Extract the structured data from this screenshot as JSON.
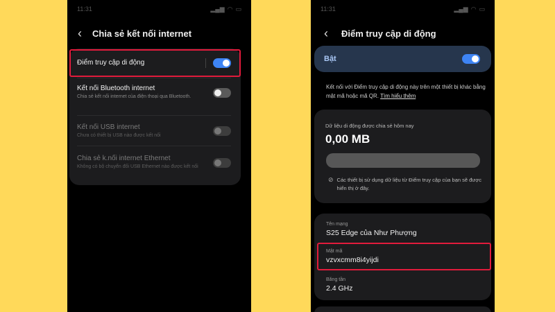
{
  "left": {
    "status": {
      "time": "11:31"
    },
    "header": {
      "title": "Chia sẻ kết nối internet"
    },
    "items": [
      {
        "title": "Điểm truy cập di động",
        "desc": "",
        "toggle": "on"
      },
      {
        "title": "Kết nối Bluetooth internet",
        "desc": "Chia sẻ kết nối internet của điện thoại qua Bluetooth.",
        "toggle": "off"
      },
      {
        "title": "Kết nối USB internet",
        "desc": "Chưa có thiết bị USB nào được kết nối",
        "toggle": "disabled"
      },
      {
        "title": "Chia sẻ k.nối internet Ethernet",
        "desc": "Không có bộ chuyển đổi USB Ethernet nào được kết nối",
        "toggle": "disabled"
      }
    ]
  },
  "right": {
    "status": {
      "time": "11:31"
    },
    "header": {
      "title": "Điểm truy cập di động"
    },
    "master": {
      "label": "Bật",
      "toggle": "on"
    },
    "info": {
      "text": "Kết nối với Điểm truy cập di động này trên một thiết bị khác bằng mật mã hoặc mã QR.",
      "link": "Tìm hiểu thêm"
    },
    "usage": {
      "label": "Dữ liệu di động được chia sẻ hôm nay",
      "value": "0,00 MB",
      "note": "Các thiết bị sử dụng dữ liệu từ Điểm truy cập của bạn sẽ được hiển thị ở đây."
    },
    "network": {
      "name_label": "Tên mạng",
      "name_value": "S25 Edge của Như Phượng",
      "pass_label": "Mật mã",
      "pass_value": "vzvxcmm8i4yijdi",
      "band_label": "Băng tần",
      "band_value": "2.4 GHz"
    }
  },
  "colors": {
    "background": "#FFD95A",
    "highlight": "#E21B3C",
    "toggle_on": "#3E84F4",
    "bat_card": "#26364d"
  }
}
